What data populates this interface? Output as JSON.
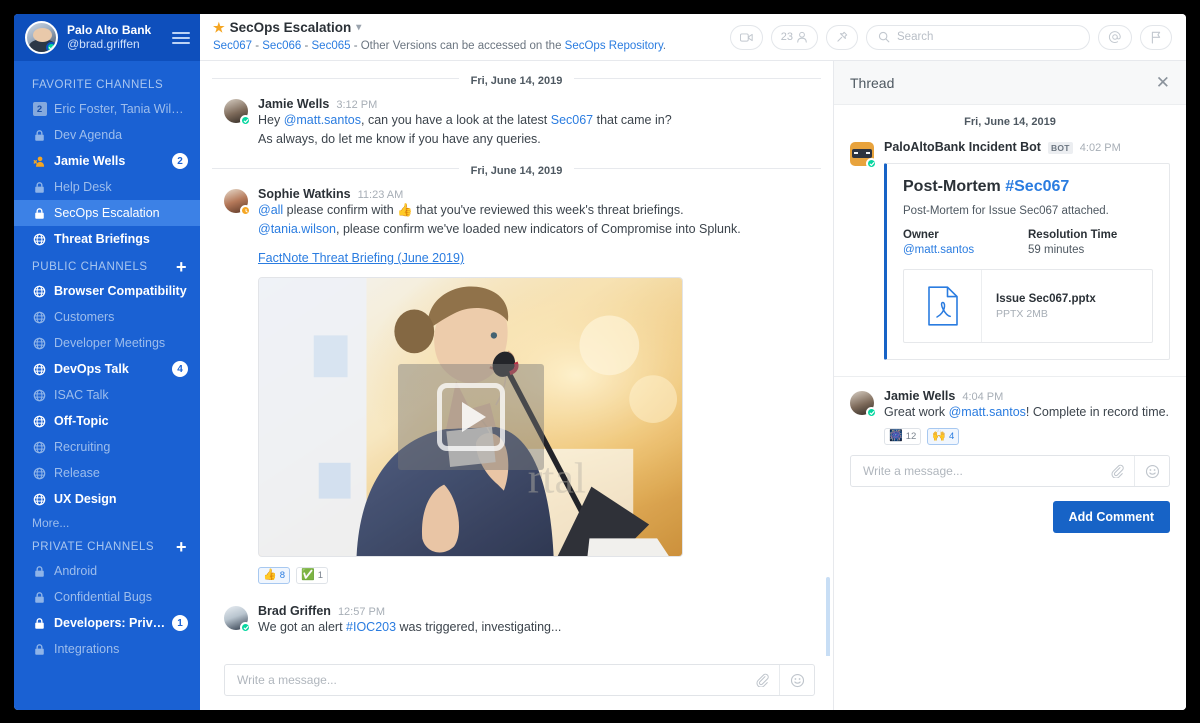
{
  "sidebar": {
    "team": {
      "name": "Palo Alto Bank",
      "handle": "@brad.griffen"
    },
    "groups": [
      {
        "title": "FAVORITE CHANNELS",
        "has_plus": false,
        "items": [
          {
            "label": "Eric Foster, Tania Wilson",
            "icon": "square-count-icon",
            "count": "2",
            "state": "muted"
          },
          {
            "label": "Dev Agenda",
            "icon": "lock-icon",
            "state": "muted"
          },
          {
            "label": "Jamie Wells",
            "icon": "person-away-icon",
            "badge": "2",
            "state": "unread"
          },
          {
            "label": "Help Desk",
            "icon": "lock-icon",
            "state": "muted"
          },
          {
            "label": "SecOps Escalation",
            "icon": "lock-icon",
            "state": "active"
          },
          {
            "label": "Threat Briefings",
            "icon": "globe-icon",
            "state": "unread"
          }
        ]
      },
      {
        "title": "PUBLIC CHANNELS",
        "has_plus": true,
        "items": [
          {
            "label": "Browser Compatibility",
            "icon": "globe-icon",
            "state": "unread"
          },
          {
            "label": "Customers",
            "icon": "globe-icon",
            "state": "muted"
          },
          {
            "label": "Developer Meetings",
            "icon": "globe-icon",
            "state": "muted"
          },
          {
            "label": "DevOps Talk",
            "icon": "globe-icon",
            "badge": "4",
            "state": "unread"
          },
          {
            "label": "ISAC Talk",
            "icon": "globe-icon",
            "state": "muted"
          },
          {
            "label": "Off-Topic",
            "icon": "globe-icon",
            "state": "unread"
          },
          {
            "label": "Recruiting",
            "icon": "globe-icon",
            "state": "muted"
          },
          {
            "label": "Release",
            "icon": "globe-icon",
            "state": "muted"
          },
          {
            "label": "UX Design",
            "icon": "globe-icon",
            "state": "unread"
          }
        ],
        "more_label": "More..."
      },
      {
        "title": "PRIVATE CHANNELS",
        "has_plus": true,
        "items": [
          {
            "label": "Android",
            "icon": "lock-icon",
            "state": "muted"
          },
          {
            "label": "Confidential Bugs",
            "icon": "lock-icon",
            "state": "muted"
          },
          {
            "label": "Developers: Private",
            "icon": "lock-icon",
            "badge": "1",
            "state": "unread"
          },
          {
            "label": "Integrations",
            "icon": "lock-icon",
            "state": "muted"
          }
        ]
      }
    ]
  },
  "topbar": {
    "channel_title": "SecOps Escalation",
    "subtitle_links": [
      "Sec067",
      "Sec066",
      "Sec065"
    ],
    "subtitle_text": " - Other Versions can be accessed on the ",
    "subtitle_link_tail": "SecOps Repository",
    "subtitle_tail_punct": ".",
    "member_count": "23",
    "search_placeholder": "Search"
  },
  "channel": {
    "date_separator_1": "Fri, June 14, 2019",
    "date_separator_2": "Fri, June 14, 2019",
    "messages": [
      {
        "author": "Jamie Wells",
        "time": "3:12 PM",
        "status": "online",
        "line1_pre": "Hey ",
        "line1_mention": "@matt.santos",
        "line1_mid": ", can you have a look at the latest ",
        "line1_link": "Sec067",
        "line1_post": " that came in?",
        "line2": "As always, do let me know if you have any queries."
      },
      {
        "author": "Sophie Watkins",
        "time": "11:23 AM",
        "status": "away",
        "line1_mention": "@all",
        "line1_mid": " please confirm with ",
        "line1_emoji": "👍",
        "line1_post": " that you've reviewed this week's threat briefings.",
        "line2_mention": "@tania.wilson",
        "line2_post": ", please confirm we've loaded new indicators of Compromise into Splunk.",
        "attachment_link": "FactNote Threat Briefing (June 2019)",
        "reactions": [
          {
            "emoji": "👍",
            "count": "8",
            "selected": true
          },
          {
            "emoji": "✅",
            "count": "1",
            "selected": false
          }
        ]
      },
      {
        "author": "Brad Griffen",
        "time": "12:57 PM",
        "status": "online",
        "line1_pre": "We got an alert ",
        "line1_link": "#IOC203",
        "line1_post": " was triggered, investigating..."
      }
    ],
    "composer_placeholder": "Write a message..."
  },
  "thread": {
    "title": "Thread",
    "date_separator": "Fri, June 14, 2019",
    "root": {
      "author": "PaloAltoBank Incident Bot",
      "bot_tag": "BOT",
      "time": "4:02 PM",
      "card": {
        "title_prefix": "Post-Mortem ",
        "title_link": "#Sec067",
        "subtitle": "Post-Mortem for Issue Sec067 attached.",
        "fields": [
          {
            "key": "Owner",
            "value": "@matt.santos",
            "is_link": true
          },
          {
            "key": "Resolution Time",
            "value": "59 minutes",
            "is_link": false
          }
        ],
        "attachment": {
          "name": "Issue Sec067.pptx",
          "meta": "PPTX 2MB",
          "icon": "pdf-file-icon"
        }
      }
    },
    "reply": {
      "author": "Jamie Wells",
      "time": "4:04 PM",
      "status": "online",
      "text_pre": "Great work ",
      "mention": "@matt.santos",
      "text_post": "! Complete in record time.",
      "reactions": [
        {
          "emoji": "🎆",
          "count": "12",
          "selected": false
        },
        {
          "emoji": "🙌",
          "count": "4",
          "selected": true
        }
      ]
    },
    "composer_placeholder": "Write a message...",
    "add_comment_label": "Add Comment"
  },
  "colors": {
    "sidebar_bg": "#1A61D3",
    "sidebar_header_bg": "#0E4FBC",
    "sidebar_active": "#3C81E6",
    "accent_blue": "#2a7ce0",
    "button_blue": "#1763C6",
    "online_green": "#06D6A0",
    "away_orange": "#F5A623"
  }
}
